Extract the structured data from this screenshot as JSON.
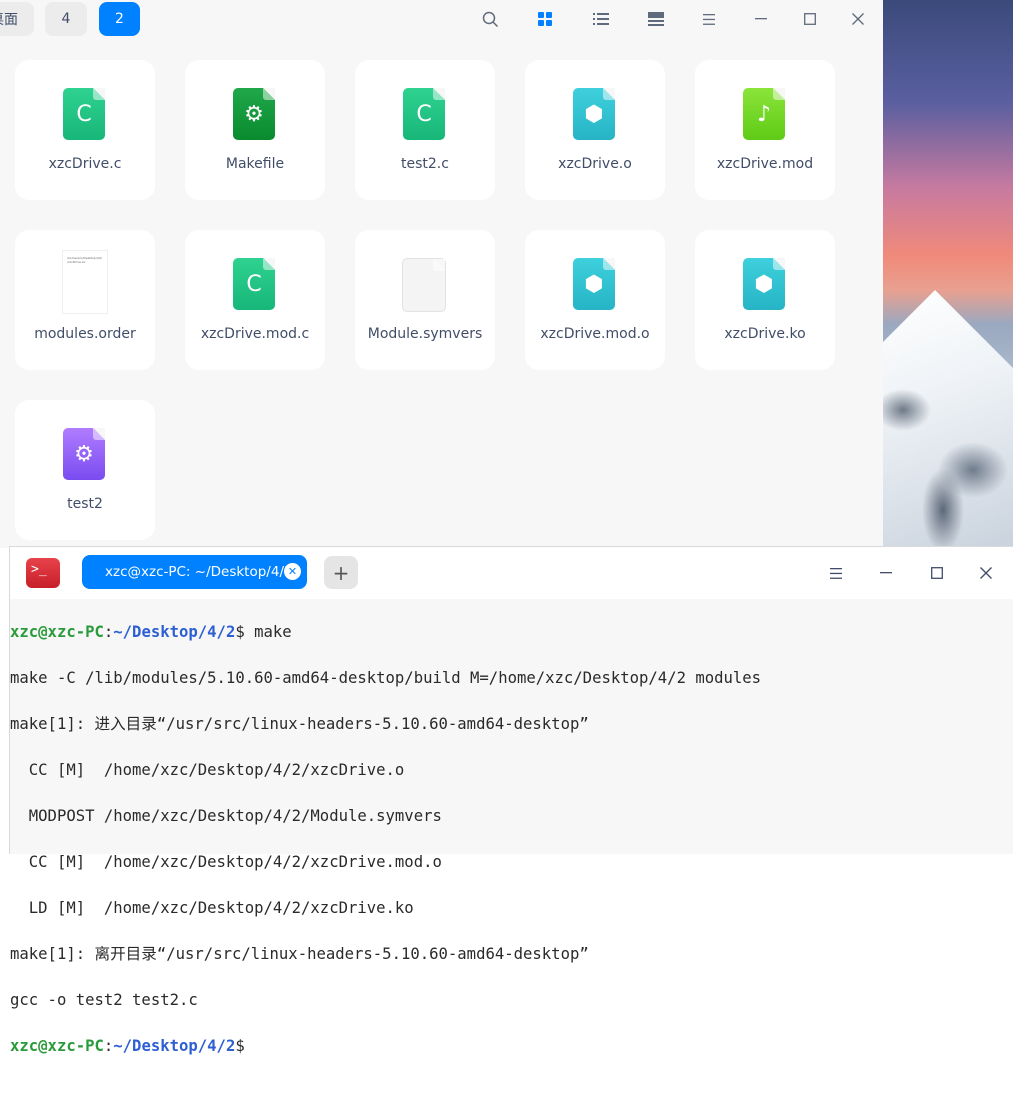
{
  "file_manager": {
    "breadcrumbs": [
      "桌面",
      "4",
      "2"
    ],
    "toolbar": {
      "search": "search-icon",
      "icon_view": "grid-view-icon",
      "list_view": "list-view-icon",
      "detail_view": "detail-view-icon",
      "menu": "menu-icon"
    },
    "files": [
      {
        "name": "xzcDrive.c",
        "icon": "c-source-icon",
        "glyph": "C"
      },
      {
        "name": "Makefile",
        "icon": "makefile-icon",
        "glyph": "⚙"
      },
      {
        "name": "test2.c",
        "icon": "c-source-icon",
        "glyph": "C"
      },
      {
        "name": "xzcDrive.o",
        "icon": "object-file-icon",
        "glyph": "⬢"
      },
      {
        "name": "xzcDrive.mod",
        "icon": "audio-file-icon",
        "glyph": "♪"
      },
      {
        "name": "modules.order",
        "icon": "text-file-icon",
        "glyph": ""
      },
      {
        "name": "xzcDrive.mod.c",
        "icon": "c-source-icon",
        "glyph": "C"
      },
      {
        "name": "Module.symvers",
        "icon": "blank-file-icon",
        "glyph": ""
      },
      {
        "name": "xzcDrive.mod.o",
        "icon": "object-file-icon",
        "glyph": "⬢"
      },
      {
        "name": "xzcDrive.ko",
        "icon": "object-file-icon",
        "glyph": "⬢"
      },
      {
        "name": "test2",
        "icon": "executable-icon",
        "glyph": "⚙"
      }
    ],
    "modules_order_preview": "/home/xzc/Desktop/4/2\n/xzcDrive.ko"
  },
  "terminal": {
    "tab_title": "xzc@xzc-PC: ~/Desktop/4/2",
    "prompt_user": "xzc@xzc-PC",
    "prompt_sep": ":",
    "prompt_path": "~/Desktop/4/2",
    "prompt_end": "$",
    "command": " make",
    "output": [
      "make -C /lib/modules/5.10.60-amd64-desktop/build M=/home/xzc/Desktop/4/2 modules",
      "make[1]: 进入目录“/usr/src/linux-headers-5.10.60-amd64-desktop”",
      "  CC [M]  /home/xzc/Desktop/4/2/xzcDrive.o",
      "  MODPOST /home/xzc/Desktop/4/2/Module.symvers",
      "  CC [M]  /home/xzc/Desktop/4/2/xzcDrive.mod.o",
      "  LD [M]  /home/xzc/Desktop/4/2/xzcDrive.ko",
      "make[1]: 离开目录“/usr/src/linux-headers-5.10.60-amd64-desktop”",
      "gcc -o test2 test2.c"
    ]
  }
}
